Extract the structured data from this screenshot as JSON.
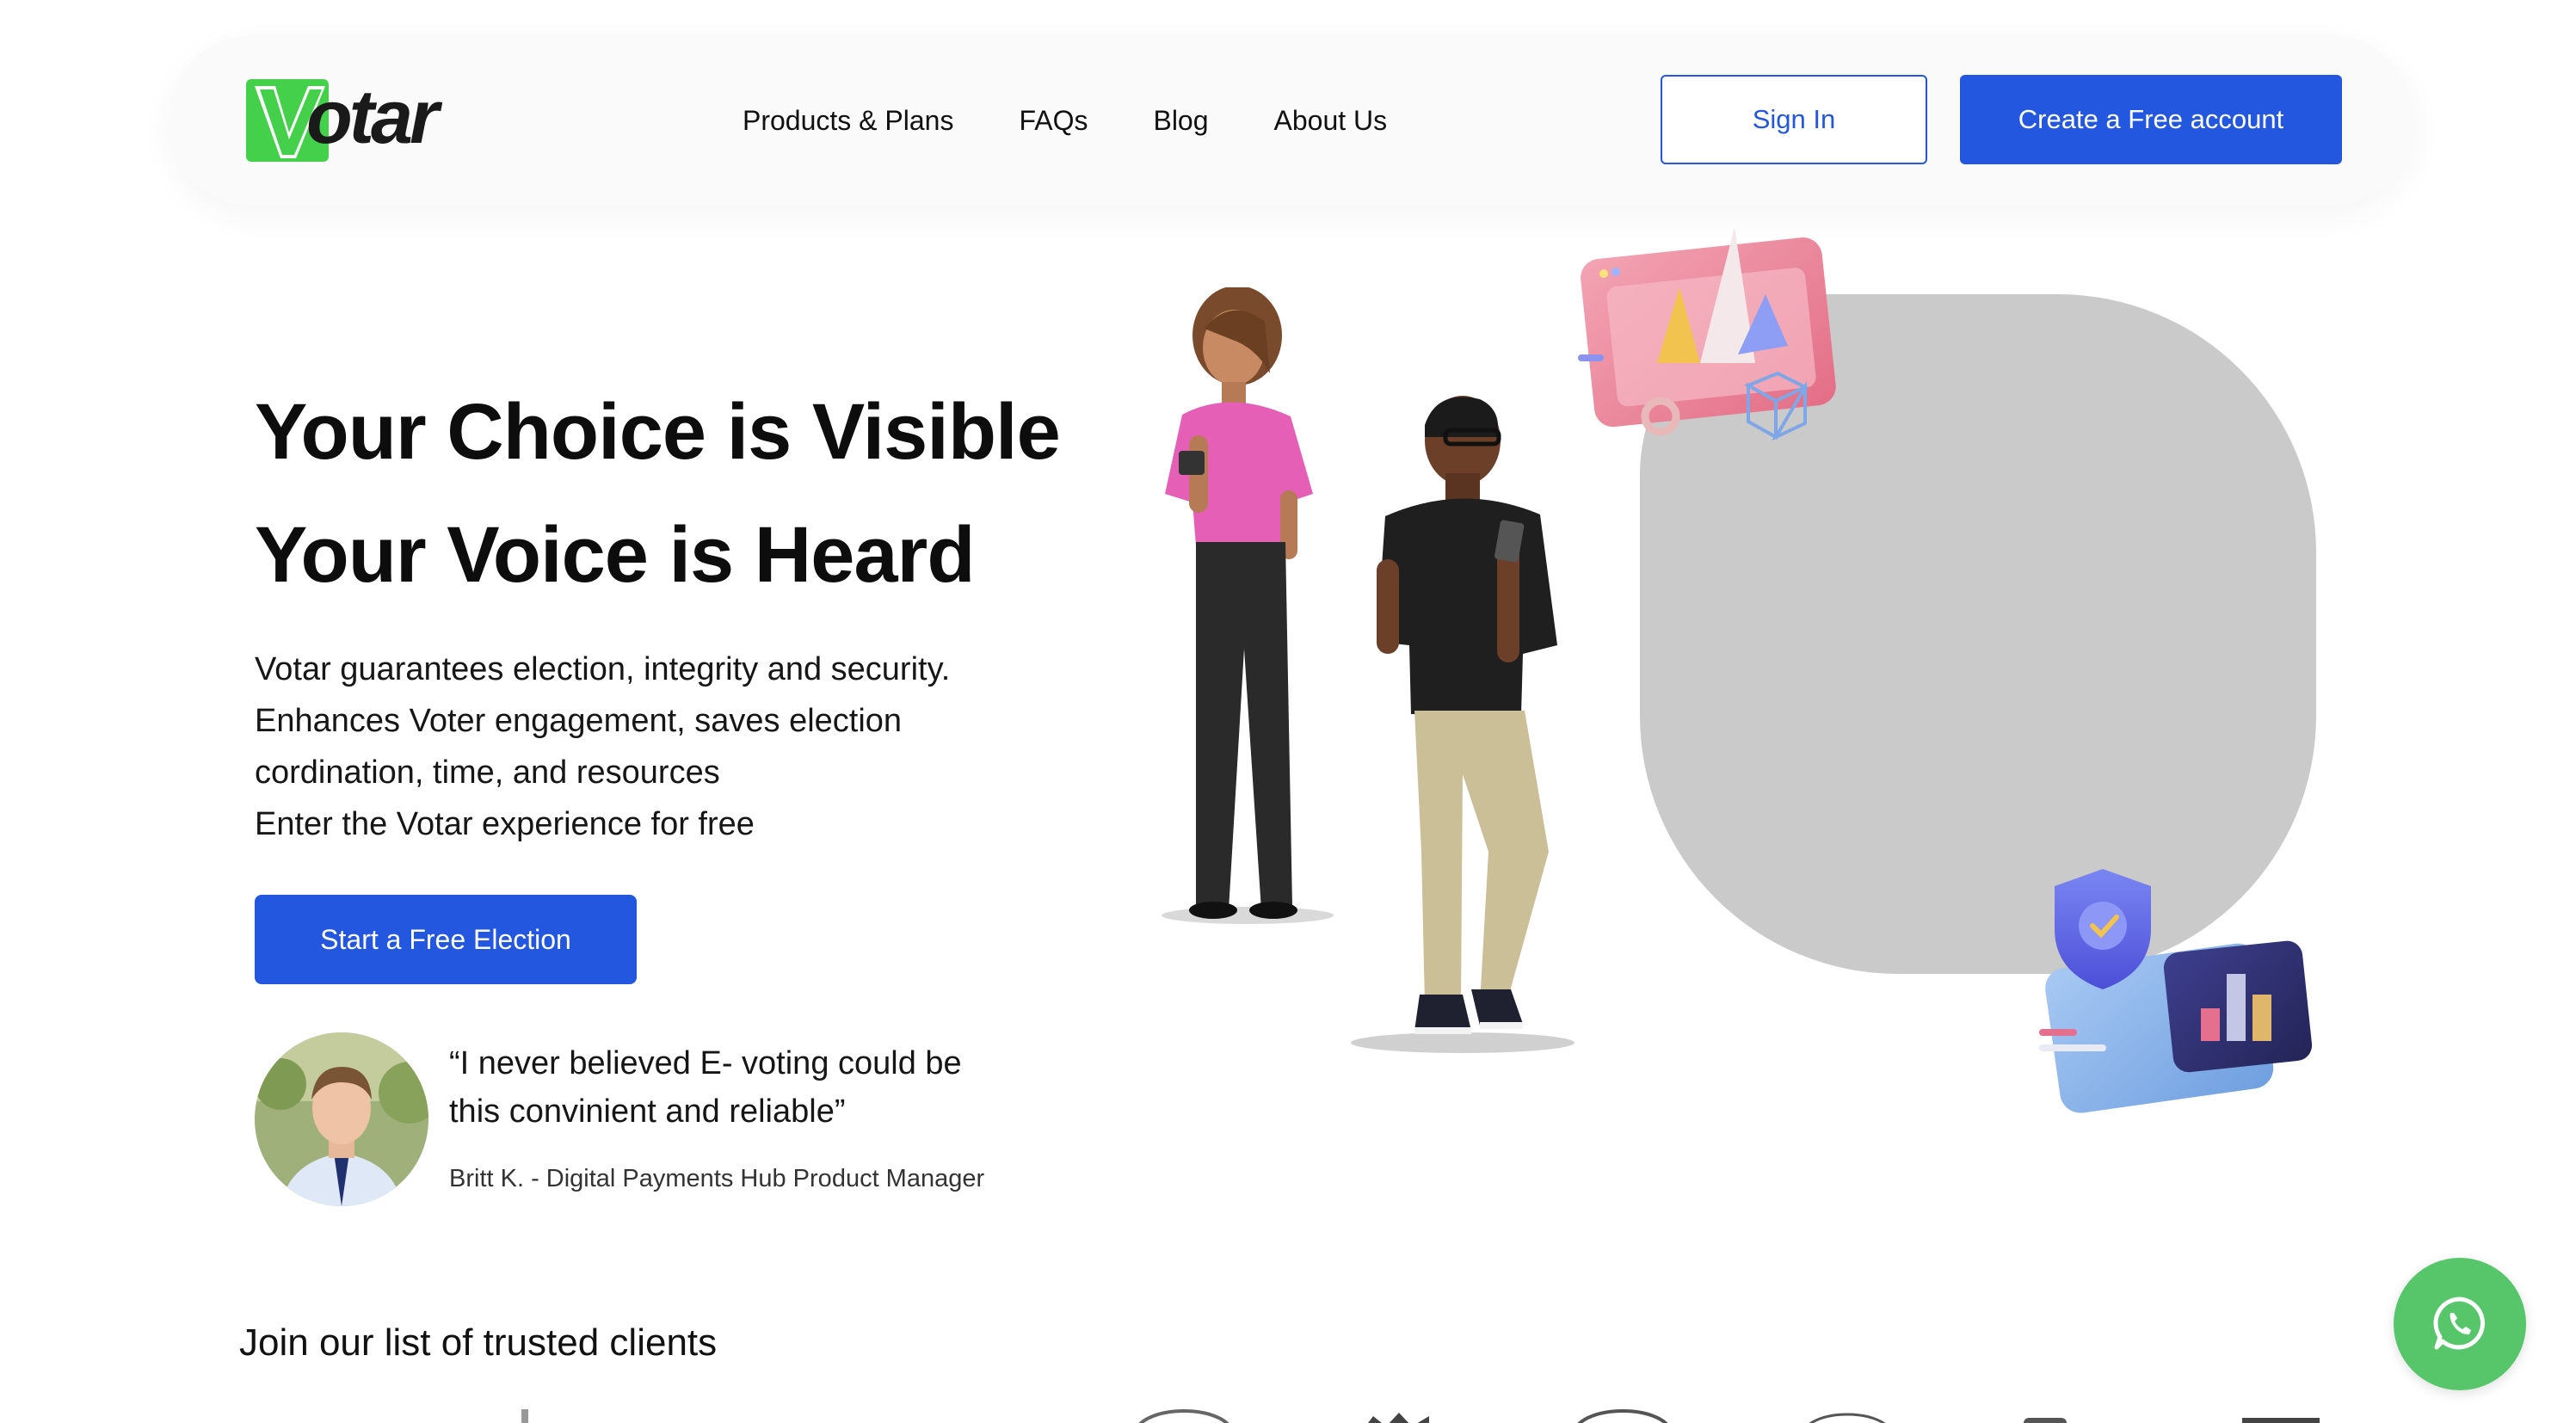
{
  "brand": {
    "name": "otar",
    "mark": "V",
    "accent_color": "#2357e0",
    "logo_green": "#44d04a"
  },
  "nav": {
    "items": [
      {
        "label": "Products & Plans"
      },
      {
        "label": "FAQs"
      },
      {
        "label": "Blog"
      },
      {
        "label": "About Us"
      }
    ],
    "sign_in": "Sign In",
    "create_account": "Create a Free account"
  },
  "hero": {
    "title_line1": "Your Choice is Visible",
    "title_line2": "Your Voice is Heard",
    "description": [
      "Votar guarantees election, integrity and security.",
      "Enhances Voter engagement, saves election",
      "cordination, time, and resources",
      "Enter the Votar experience for free"
    ],
    "cta": "Start a Free Election"
  },
  "testimonial": {
    "quote_lines": [
      "“I never believed E- voting could be",
      "this convinient and reliable”"
    ],
    "author": "Britt K. - Digital Payments Hub Product Manager"
  },
  "clients": {
    "title": "Join our list of trusted clients"
  },
  "icons": {
    "whatsapp": "whatsapp-icon",
    "illustration": [
      "woman-with-phone",
      "man-with-phone",
      "chart-window",
      "shield-check",
      "bar-chart-card"
    ]
  },
  "colors": {
    "whatsapp": "#57c66a",
    "blob": "#cacaca"
  }
}
